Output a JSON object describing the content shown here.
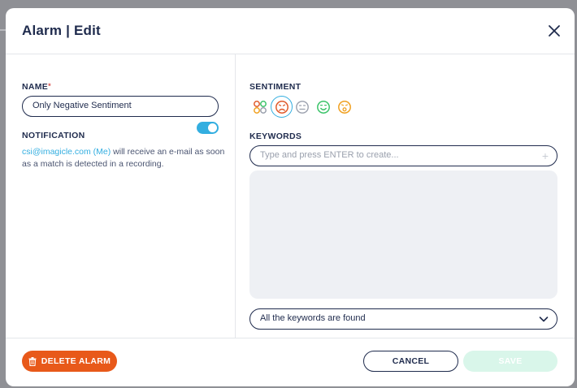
{
  "dialog": {
    "title": "Alarm | Edit"
  },
  "name_field": {
    "label": "NAME",
    "required_mark": "*",
    "value": "Only Negative Sentiment"
  },
  "notification": {
    "label": "NOTIFICATION",
    "enabled": true,
    "email": "csi@imagicle.com (Me)",
    "message": " will receive an e-mail as soon as a match is detected in a recording."
  },
  "sentiment": {
    "label": "SENTIMENT",
    "options": [
      {
        "icon": "all-sentiments-icon"
      },
      {
        "icon": "negative-face-icon",
        "selected": true,
        "color": "#e05a2b"
      },
      {
        "icon": "neutral-face-icon",
        "color": "#9aa0ad"
      },
      {
        "icon": "positive-face-icon",
        "color": "#3cc46a"
      },
      {
        "icon": "surprised-face-icon",
        "color": "#f0a020"
      }
    ]
  },
  "keywords": {
    "label": "KEYWORDS",
    "placeholder": "Type and press ENTER to create...",
    "match_mode": "All the keywords are found"
  },
  "footer": {
    "delete_label": "DELETE ALARM",
    "cancel_label": "CANCEL",
    "save_label": "SAVE"
  },
  "colors": {
    "primary_navy": "#1f2b4d",
    "accent_blue": "#33aee0",
    "delete_orange": "#e8591a",
    "save_disabled": "#d9f6ea"
  }
}
